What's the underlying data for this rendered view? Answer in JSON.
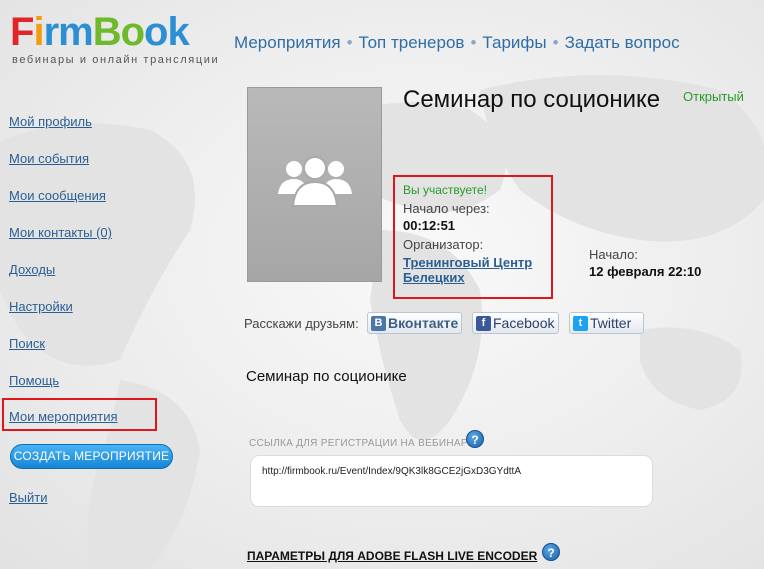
{
  "brand": {
    "logo_letters": [
      {
        "ch": "F",
        "color": "#e0262a"
      },
      {
        "ch": "i",
        "color": "#f39c12"
      },
      {
        "ch": "r",
        "color": "#2c8fd6"
      },
      {
        "ch": "m",
        "color": "#2c8fd6"
      },
      {
        "ch": "B",
        "color": "#6fb92c"
      },
      {
        "ch": "o",
        "color": "#6fb92c"
      },
      {
        "ch": "o",
        "color": "#2c8fd6"
      },
      {
        "ch": "k",
        "color": "#2c8fd6"
      }
    ],
    "tagline": "вебинары и онлайн трансляции"
  },
  "topnav": {
    "items": [
      "Мероприятия",
      "Топ тренеров",
      "Тарифы",
      "Задать вопрос"
    ],
    "separator": "•"
  },
  "sidebar": {
    "items": [
      {
        "label": "Мой профиль"
      },
      {
        "label": "Мои события"
      },
      {
        "label": "Мои сообщения"
      },
      {
        "label": "Мои контакты (0)"
      },
      {
        "label": "Доходы"
      },
      {
        "label": "Настройки"
      },
      {
        "label": "Поиск"
      },
      {
        "label": "Помощь"
      },
      {
        "label": "Мои мероприятия"
      }
    ],
    "create_button": "СОЗДАТЬ МЕРОПРИЯТИЕ",
    "logout": "Выйти"
  },
  "event": {
    "title": "Семинар по соционике",
    "status": "Открытый",
    "participating": "Вы участвуете!",
    "starts_in_label": "Начало через:",
    "countdown": "00:12:51",
    "organizer_label": "Организатор:",
    "organizer_line1": "Тренинговый Центр",
    "organizer_line2": "Белецких",
    "start_label": "Начало:",
    "start_value": "12 февраля 22:10",
    "description": "Семинар по соционике"
  },
  "share": {
    "label": "Расскажи друзьям:",
    "vk": "Вконтакте",
    "vk_icon": "B",
    "facebook": "Facebook",
    "facebook_icon": "f",
    "twitter": "Twitter",
    "twitter_icon": "t"
  },
  "registration": {
    "label": "ССЫЛКА ДЛЯ РЕГИСТРАЦИИ НА ВЕБИНАР:",
    "url": "http://firmbook.ru/Event/Index/9QK3lk8GCE2jGxD3GYdttA",
    "help": "?"
  },
  "flash": {
    "label": "ПАРАМЕТРЫ ДЛЯ ADOBE FLASH LIVE ENCODER",
    "help": "?"
  },
  "colors": {
    "link": "#2b5f94",
    "nav": "#2f6da8",
    "status_green": "#2a9a2a",
    "highlight_red": "#e0161c",
    "vk": "#4a76a8",
    "facebook": "#3b5998",
    "twitter": "#1da1f2"
  }
}
